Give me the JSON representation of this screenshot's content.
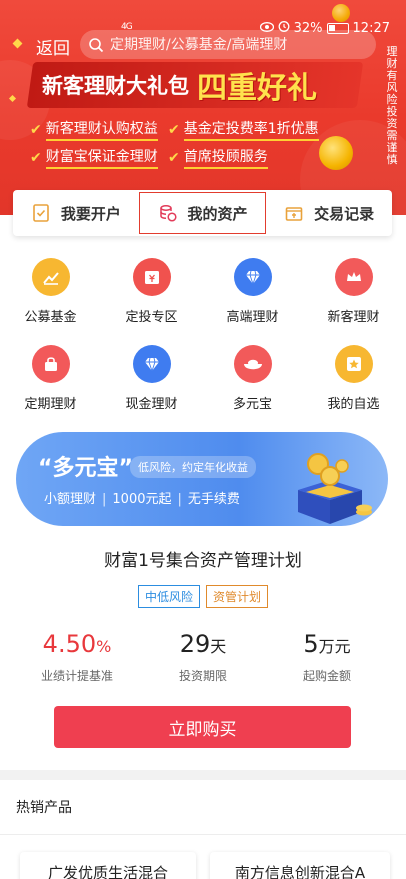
{
  "status_bar": {
    "signal": "4G",
    "battery": "32%",
    "time": "12:27"
  },
  "header": {
    "back_label": "返回",
    "search_placeholder": "定期理财/公募基金/高端理财",
    "side_tip": "理财有风险 投资需谨慎"
  },
  "promo": {
    "title": "新客理财大礼包",
    "highlight": "四重好礼",
    "benefits": [
      "新客理财认购权益",
      "基金定投费率1折优惠",
      "财富宝保证金理财",
      "首席投顾服务"
    ]
  },
  "tabs": [
    {
      "label": "我要开户",
      "icon": "id-card-icon"
    },
    {
      "label": "我的资产",
      "icon": "coins-icon",
      "active": true
    },
    {
      "label": "交易记录",
      "icon": "ledger-icon"
    }
  ],
  "grid": [
    {
      "label": "公募基金",
      "icon": "fund-chart-icon",
      "color": "#f7b731"
    },
    {
      "label": "定投专区",
      "icon": "calendar-yuan-icon",
      "color": "#f0524e"
    },
    {
      "label": "高端理财",
      "icon": "diamond-icon",
      "color": "#3f7cf0"
    },
    {
      "label": "新客理财",
      "icon": "crown-icon",
      "color": "#f25a5a"
    },
    {
      "label": "定期理财",
      "icon": "lock-bag-icon",
      "color": "#f2595a"
    },
    {
      "label": "现金理财",
      "icon": "diamond-icon",
      "color": "#3f7cf0"
    },
    {
      "label": "多元宝",
      "icon": "ingot-icon",
      "color": "#f25a5a"
    },
    {
      "label": "我的自选",
      "icon": "star-icon",
      "color": "#f7b731"
    }
  ],
  "dyb_banner": {
    "title": "“多元宝”",
    "pill": "低风险，约定年化收益",
    "sub": [
      "小额理财",
      "1000元起",
      "无手续费"
    ]
  },
  "product": {
    "name": "财富1号集合资产管理计划",
    "tags": [
      "中低风险",
      "资管计划"
    ],
    "stats": [
      {
        "value": "4.50",
        "unit": "%",
        "label": "业绩计提基准"
      },
      {
        "value": "29",
        "unit": "天",
        "label": "投资期限"
      },
      {
        "value": "5",
        "unit": "万元",
        "label": "起购金额"
      }
    ],
    "buy_label": "立即购买"
  },
  "hot": {
    "title": "热销产品",
    "cards": [
      "广发优质生活混合",
      "南方信息创新混合A"
    ]
  }
}
